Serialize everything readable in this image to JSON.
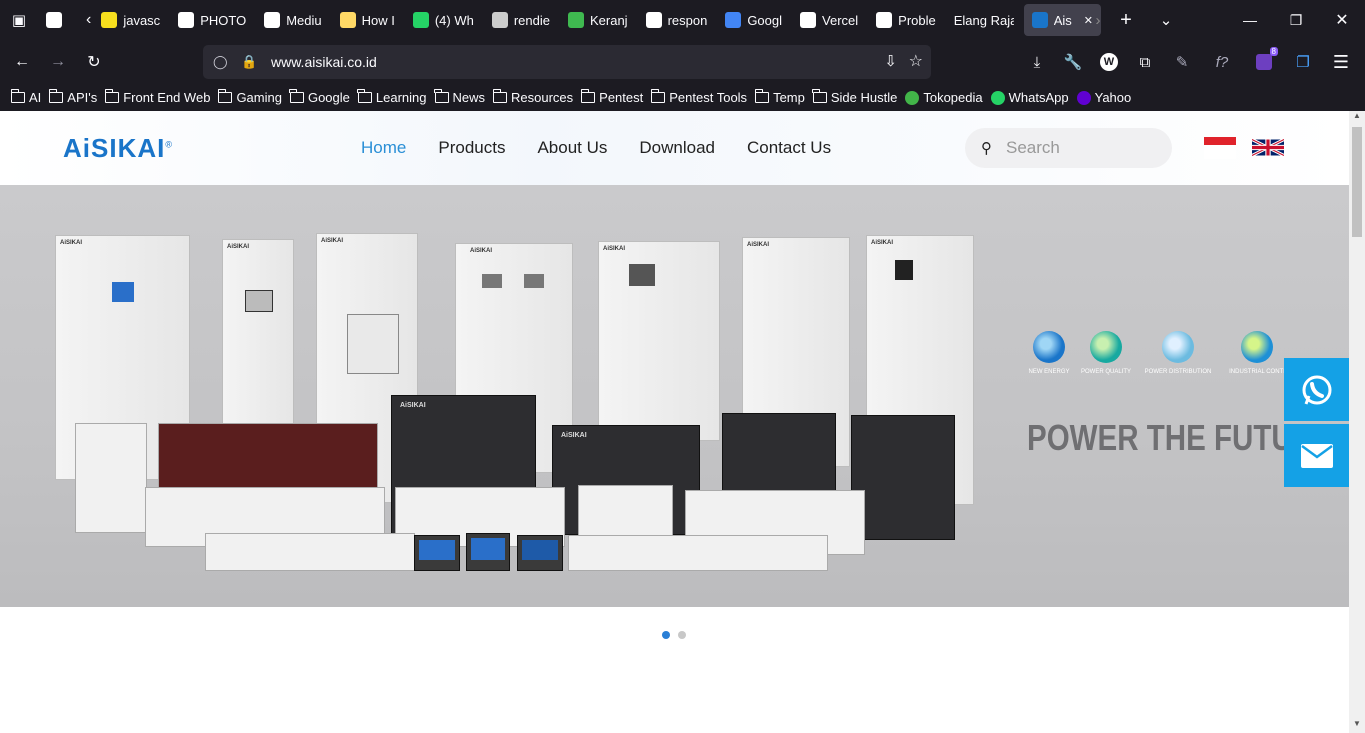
{
  "browser": {
    "tabs": [
      {
        "label": "",
        "icon": "google-icon",
        "color": "#ffffff"
      },
      {
        "label": "javasc",
        "icon": "js-icon",
        "color": "#f7df1e"
      },
      {
        "label": "PHOTO",
        "icon": "openai-icon",
        "color": "#ffffff"
      },
      {
        "label": "Mediu",
        "icon": "medium-icon",
        "color": "#ffffff"
      },
      {
        "label": "How I",
        "icon": "face-icon",
        "color": "#ffd966"
      },
      {
        "label": "(4) Wh",
        "icon": "whatsapp-icon",
        "color": "#25d366"
      },
      {
        "label": "rendie",
        "icon": "github-icon",
        "color": "#cccccc"
      },
      {
        "label": "Keranj",
        "icon": "owl-icon",
        "color": "#3fb950"
      },
      {
        "label": "respon",
        "icon": "google-icon",
        "color": "#ffffff"
      },
      {
        "label": "Googl",
        "icon": "translate-icon",
        "color": "#4285f4"
      },
      {
        "label": "Vercel",
        "icon": "vercel-icon",
        "color": "#ffffff"
      },
      {
        "label": "Proble",
        "icon": "info-icon",
        "color": "#ffffff"
      },
      {
        "label": "Elang Raja",
        "icon": "",
        "color": ""
      },
      {
        "label": "Aisi",
        "icon": "aisikai-icon",
        "color": "#1a75c9",
        "active": true
      }
    ],
    "url": "www.aisikai.co.id",
    "extension_badge": "8",
    "bookmarks": [
      {
        "label": "AI",
        "type": "folder"
      },
      {
        "label": "API's",
        "type": "folder"
      },
      {
        "label": "Front End Web",
        "type": "folder"
      },
      {
        "label": "Gaming",
        "type": "folder"
      },
      {
        "label": "Google",
        "type": "folder"
      },
      {
        "label": "Learning",
        "type": "folder"
      },
      {
        "label": "News",
        "type": "folder"
      },
      {
        "label": "Resources",
        "type": "folder"
      },
      {
        "label": "Pentest",
        "type": "folder"
      },
      {
        "label": "Pentest Tools",
        "type": "folder"
      },
      {
        "label": "Temp",
        "type": "folder"
      },
      {
        "label": "Side Hustle",
        "type": "folder"
      },
      {
        "label": "Tokopedia",
        "type": "link",
        "icon": "tokopedia-icon",
        "color": "#42b549"
      },
      {
        "label": "WhatsApp",
        "type": "link",
        "icon": "whatsapp-icon",
        "color": "#25d366"
      },
      {
        "label": "Yahoo",
        "type": "link",
        "icon": "yahoo-icon",
        "color": "#6001d2"
      }
    ]
  },
  "site": {
    "logo": "AiSIKAI",
    "logo_mark": "®",
    "nav": [
      "Home",
      "Products",
      "About Us",
      "Download",
      "Contact Us"
    ],
    "active_nav": "Home",
    "search_placeholder": "Search",
    "brand_color": "#1a75c9",
    "accent_color": "#14a1e6",
    "hero": {
      "categories": [
        "NEW ENERGY",
        "POWER QUALITY",
        "POWER DISTRIBUTION",
        "INDUSTRIAL CONTI"
      ],
      "slogan": "POWER THE FUTUR",
      "cabinet_label": "AiSIKAI"
    },
    "carousel": {
      "total": 2,
      "active": 1
    }
  }
}
